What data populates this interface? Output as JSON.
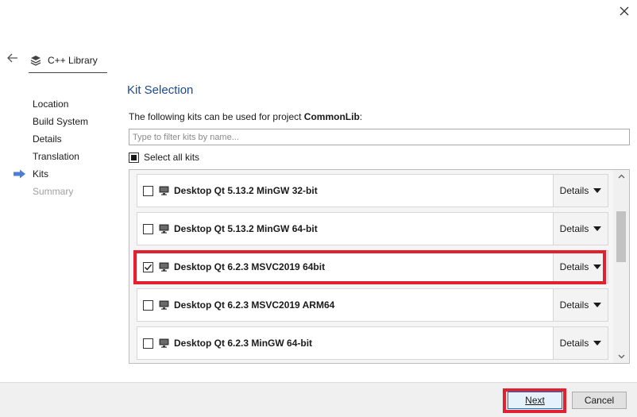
{
  "wizard": {
    "title": "C++ Library",
    "icons": {
      "back": "back-arrow-icon",
      "close": "close-icon",
      "project": "library-stack-icon"
    }
  },
  "steps": [
    {
      "label": "Location",
      "state": "done"
    },
    {
      "label": "Build System",
      "state": "done"
    },
    {
      "label": "Details",
      "state": "done"
    },
    {
      "label": "Translation",
      "state": "done"
    },
    {
      "label": "Kits",
      "state": "current"
    },
    {
      "label": "Summary",
      "state": "pending"
    }
  ],
  "page": {
    "heading": "Kit Selection",
    "intro_prefix": "The following kits can be used for project ",
    "project_name": "CommonLib",
    "intro_suffix": ":",
    "filter_placeholder": "Type to filter kits by name...",
    "select_all_label": "Select all kits",
    "select_all_state": "partial"
  },
  "kits": [
    {
      "name": "Desktop Qt 5.13.2 MinGW 32-bit",
      "checked": false,
      "details_label": "Details"
    },
    {
      "name": "Desktop Qt 5.13.2 MinGW 64-bit",
      "checked": false,
      "details_label": "Details"
    },
    {
      "name": "Desktop Qt 6.2.3 MSVC2019 64bit",
      "checked": true,
      "details_label": "Details"
    },
    {
      "name": "Desktop Qt 6.2.3 MSVC2019 ARM64",
      "checked": false,
      "details_label": "Details"
    },
    {
      "name": "Desktop Qt 6.2.3 MinGW 64-bit",
      "checked": false,
      "details_label": "Details"
    }
  ],
  "footer": {
    "next_label": "Next",
    "cancel_label": "Cancel"
  },
  "colors": {
    "accent_heading": "#1a4a8f",
    "current_step_arrow": "#4a7fd4",
    "highlight_red": "#e3202f"
  }
}
